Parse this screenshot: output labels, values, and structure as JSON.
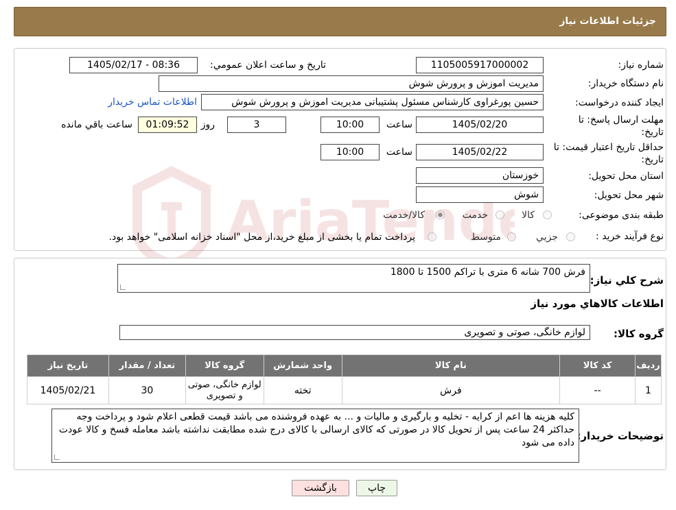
{
  "header": {
    "title": "جزئیات اطلاعات نیاز"
  },
  "fields": {
    "need_number_label": "شماره نیاز:",
    "need_number": "1105005917000002",
    "announce_label": "تاریخ و ساعت اعلان عمومي:",
    "announce_value": "1405/02/17 - 08:36",
    "buyer_org_label": "نام دستگاه خریدار:",
    "buyer_org": "مدیریت اموزش و پرورش شوش",
    "creator_label": "ایجاد کننده درخواست:",
    "creator": "حسین پورغراوی کارشناس مسئول پشتیبانی مدیریت اموزش و پرورش شوش",
    "contact_link": "اطلاعات تماس خریدار",
    "deadline_label": "مهلت ارسال پاسخ: تا تاریخ:",
    "deadline_date": "1405/02/20",
    "deadline_time_label": "ساعت",
    "deadline_time": "10:00",
    "days_value": "3",
    "days_label": "روز و",
    "remaining_time": "01:09:52",
    "remaining_label": "ساعت باقي مانده",
    "validity_label": "حداقل تاریخ اعتبار قیمت: تا تاریخ:",
    "validity_date": "1405/02/22",
    "validity_time_label": "ساعت",
    "validity_time": "10:00",
    "province_label": "استان محل تحویل:",
    "province": "خوزستان",
    "city_label": "شهر محل تحویل:",
    "city": "شوش",
    "category_label": "طبقه بندی موضوعی:",
    "category_options": [
      "کالا",
      "خدمت",
      "کالا/خدمت"
    ],
    "process_label": "نوع فرآیند خرید :",
    "process_options": [
      "جزیي",
      "متوسط"
    ],
    "process_note": "پرداخت تمام یا بخشی از مبلغ خرید،از محل \"اسناد خزانه اسلامی\" خواهد بود."
  },
  "summary": {
    "label": "شرح کلي نياز:",
    "text": "فرش 700 شانه 6 متری با تراکم 1500 تا 1800",
    "goods_info_heading": "اطلاعات کالاهاي مورد نياز",
    "goods_group_label": "گروه کالا:",
    "goods_group": "لوازم خانگی، صوتی و تصویری"
  },
  "table": {
    "headers": [
      "رديف",
      "کد کالا",
      "نام کالا",
      "واحد شمارش",
      "گروه کالا",
      "تعداد / مقدار",
      "تاريخ نياز"
    ],
    "rows": [
      [
        "1",
        "--",
        "فرش",
        "تخته",
        "لوازم خانگی، صوتی و تصویری",
        "30",
        "1405/02/21"
      ]
    ]
  },
  "buyer_notes": {
    "label": "توضیحات خریدار:",
    "text": "کلیه هزینه ها اعم از کرایه - تخلیه و بارگیری و مالیات و ... به عهده فروشنده می باشد  قیمت قطعی اعلام شود و پرداخت وجه حداکثر 24 ساعت پس از تحویل کالا در صورتی که کالای ارسالی با کالای درج شده مطابقت نداشته باشد معامله فسخ و کالا عودت داده می شود"
  },
  "buttons": {
    "print": "چاپ",
    "back": "بازگشت"
  },
  "watermark": {
    "text": "AriaTender.neT"
  },
  "colors": {
    "header_bg": "#997a4a",
    "table_header_bg": "#737373",
    "link": "#1a55c4"
  }
}
